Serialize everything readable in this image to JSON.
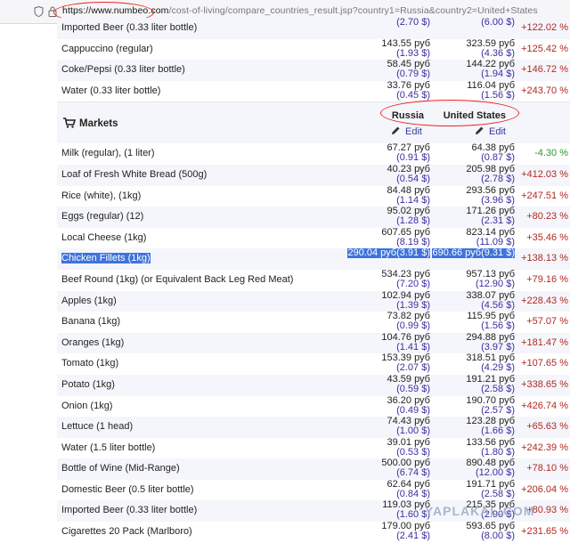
{
  "browser": {
    "url_host": "https://www.numbeo.com",
    "url_path": "/cost-of-living/compare_countries_result.jsp?country1=Russia&country2=United+States"
  },
  "top_rows": [
    {
      "name": "Imported Beer (0.33 liter bottle)",
      "c1_rub": "",
      "c1_usd": "(2.70 $)",
      "c2_rub": "",
      "c2_usd": "(6.00 $)",
      "diff": "+122.02 %"
    },
    {
      "name": "Cappuccino (regular)",
      "c1_rub": "143.55 руб",
      "c1_usd": "(1.93 $)",
      "c2_rub": "323.59 руб",
      "c2_usd": "(4.36 $)",
      "diff": "+125.42 %"
    },
    {
      "name": "Coke/Pepsi (0.33 liter bottle)",
      "c1_rub": "58.45 руб",
      "c1_usd": "(0.79 $)",
      "c2_rub": "144.22 руб",
      "c2_usd": "(1.94 $)",
      "diff": "+146.72 %"
    },
    {
      "name": "Water (0.33 liter bottle)",
      "c1_rub": "33.76 руб",
      "c1_usd": "(0.45 $)",
      "c2_rub": "116.04 руб",
      "c2_usd": "(1.56 $)",
      "diff": "+243.70 %"
    }
  ],
  "markets": {
    "title": "Markets",
    "country1": "Russia",
    "country2": "United States",
    "edit_label": "Edit"
  },
  "market_rows": [
    {
      "name": "Milk (regular), (1 liter)",
      "c1_rub": "67.27 руб",
      "c1_usd": "(0.91 $)",
      "c2_rub": "64.38 руб",
      "c2_usd": "(0.87 $)",
      "diff": "-4.30 %"
    },
    {
      "name": "Loaf of Fresh White Bread (500g)",
      "c1_rub": "40.23 руб",
      "c1_usd": "(0.54 $)",
      "c2_rub": "205.98 руб",
      "c2_usd": "(2.78 $)",
      "diff": "+412.03 %"
    },
    {
      "name": "Rice (white), (1kg)",
      "c1_rub": "84.48 руб",
      "c1_usd": "(1.14 $)",
      "c2_rub": "293.56 руб",
      "c2_usd": "(3.96 $)",
      "diff": "+247.51 %"
    },
    {
      "name": "Eggs (regular) (12)",
      "c1_rub": "95.02 руб",
      "c1_usd": "(1.28 $)",
      "c2_rub": "171.26 руб",
      "c2_usd": "(2.31 $)",
      "diff": "+80.23 %"
    },
    {
      "name": "Local Cheese (1kg)",
      "c1_rub": "607.65 руб",
      "c1_usd": "(8.19 $)",
      "c2_rub": "823.14 руб",
      "c2_usd": "(11.09 $)",
      "diff": "+35.46 %"
    },
    {
      "name": "Chicken Fillets (1kg)",
      "c1_rub": "290.04 руб",
      "c1_usd": "(3.91 $)",
      "c2_rub": "690.66 руб",
      "c2_usd": "(9.31 $)",
      "diff": "+138.13 %"
    },
    {
      "name": "Beef Round (1kg) (or Equivalent Back Leg Red Meat)",
      "c1_rub": "534.23 руб",
      "c1_usd": "(7.20 $)",
      "c2_rub": "957.13 руб",
      "c2_usd": "(12.90 $)",
      "diff": "+79.16 %"
    },
    {
      "name": "Apples (1kg)",
      "c1_rub": "102.94 руб",
      "c1_usd": "(1.39 $)",
      "c2_rub": "338.07 руб",
      "c2_usd": "(4.56 $)",
      "diff": "+228.43 %"
    },
    {
      "name": "Banana (1kg)",
      "c1_rub": "73.82 руб",
      "c1_usd": "(0.99 $)",
      "c2_rub": "115.95 руб",
      "c2_usd": "(1.56 $)",
      "diff": "+57.07 %"
    },
    {
      "name": "Oranges (1kg)",
      "c1_rub": "104.76 руб",
      "c1_usd": "(1.41 $)",
      "c2_rub": "294.88 руб",
      "c2_usd": "(3.97 $)",
      "diff": "+181.47 %"
    },
    {
      "name": "Tomato (1kg)",
      "c1_rub": "153.39 руб",
      "c1_usd": "(2.07 $)",
      "c2_rub": "318.51 руб",
      "c2_usd": "(4.29 $)",
      "diff": "+107.65 %"
    },
    {
      "name": "Potato (1kg)",
      "c1_rub": "43.59 руб",
      "c1_usd": "(0.59 $)",
      "c2_rub": "191.21 руб",
      "c2_usd": "(2.58 $)",
      "diff": "+338.65 %"
    },
    {
      "name": "Onion (1kg)",
      "c1_rub": "36.20 руб",
      "c1_usd": "(0.49 $)",
      "c2_rub": "190.70 руб",
      "c2_usd": "(2.57 $)",
      "diff": "+426.74 %"
    },
    {
      "name": "Lettuce (1 head)",
      "c1_rub": "74.43 руб",
      "c1_usd": "(1.00 $)",
      "c2_rub": "123.28 руб",
      "c2_usd": "(1.66 $)",
      "diff": "+65.63 %"
    },
    {
      "name": "Water (1.5 liter bottle)",
      "c1_rub": "39.01 руб",
      "c1_usd": "(0.53 $)",
      "c2_rub": "133.56 руб",
      "c2_usd": "(1.80 $)",
      "diff": "+242.39 %"
    },
    {
      "name": "Bottle of Wine (Mid-Range)",
      "c1_rub": "500.00 руб",
      "c1_usd": "(6.74 $)",
      "c2_rub": "890.48 руб",
      "c2_usd": "(12.00 $)",
      "diff": "+78.10 %"
    },
    {
      "name": "Domestic Beer (0.5 liter bottle)",
      "c1_rub": "62.64 руб",
      "c1_usd": "(0.84 $)",
      "c2_rub": "191.71 руб",
      "c2_usd": "(2.58 $)",
      "diff": "+206.04 %"
    },
    {
      "name": "Imported Beer (0.33 liter bottle)",
      "c1_rub": "119.03 руб",
      "c1_usd": "(1.60 $)",
      "c2_rub": "215.35 руб",
      "c2_usd": "(2.90 $)",
      "diff": "+80.93 %"
    },
    {
      "name": "Cigarettes 20 Pack (Marlboro)",
      "c1_rub": "179.00 руб",
      "c1_usd": "(2.41 $)",
      "c2_rub": "593.65 руб",
      "c2_usd": "(8.00 $)",
      "diff": "+231.65 %"
    }
  ],
  "highlighted_row": "Chicken Fillets (1kg)",
  "watermark": "YAPLAKAL.COM",
  "colors": {
    "positive": "#b02a22",
    "negative": "#2a9a2a",
    "usd": "#3a2ea0",
    "selection": "#3d73db",
    "annotation": "#e22222"
  }
}
